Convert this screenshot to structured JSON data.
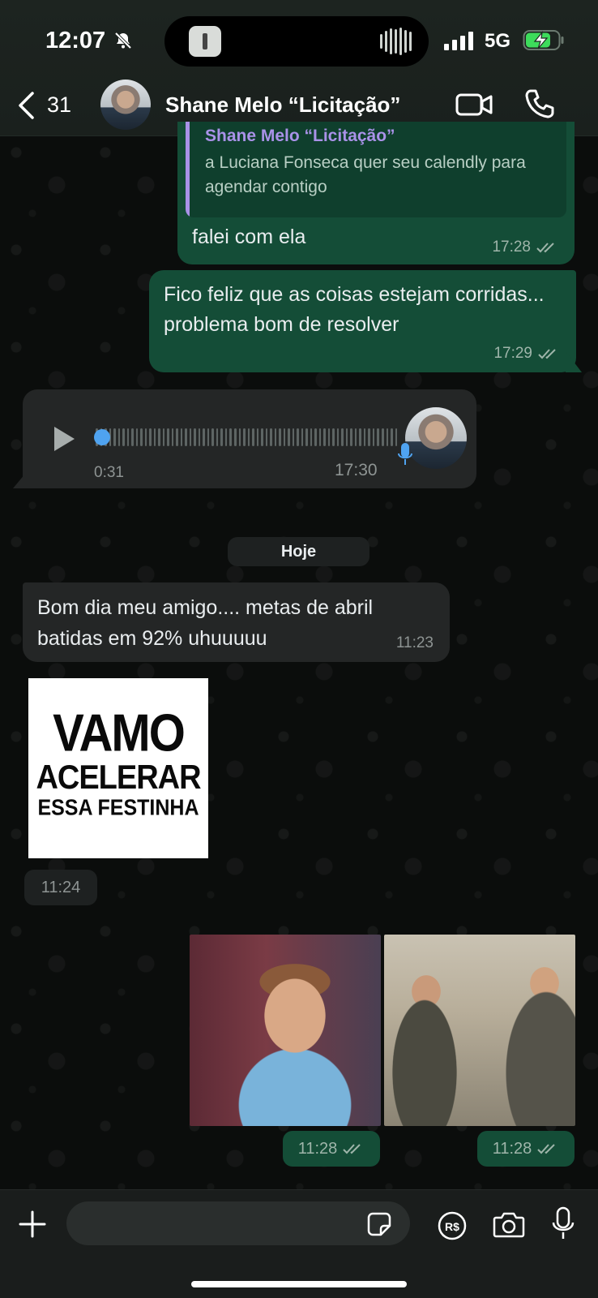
{
  "status_bar": {
    "time": "12:07",
    "network": "5G"
  },
  "header": {
    "back_count": "31",
    "contact_name": "Shane Melo “Licitação”"
  },
  "messages": {
    "quoted": {
      "name": "Shane Melo “Licitação”",
      "text": "a Luciana Fonseca quer seu calendly para agendar contigo"
    },
    "reply": {
      "text": "falei com ela",
      "time": "17:28"
    },
    "out2": {
      "text": "Fico feliz que as coisas estejam corridas... problema bom de resolver",
      "time": "17:29"
    },
    "voice": {
      "duration": "0:31",
      "time": "17:30"
    },
    "date_divider": "Hoje",
    "in1": {
      "text": "Bom dia meu amigo.... metas de abril batidas em 92% uhuuuuu",
      "time": "11:23"
    },
    "sticker": {
      "line1": "VAMO",
      "line2": "ACELERAR",
      "line3": "ESSA FESTINHA",
      "time": "11:24"
    },
    "gif1": {
      "time": "11:28"
    },
    "gif2": {
      "time": "11:28"
    }
  },
  "composer": {
    "value": "",
    "placeholder": ""
  },
  "colors": {
    "outgoing_bubble": "#144d37",
    "incoming_bubble": "#242626",
    "background": "#0b0d0c",
    "accent_blue": "#4fa3f0",
    "quote_name": "#a992e8"
  }
}
